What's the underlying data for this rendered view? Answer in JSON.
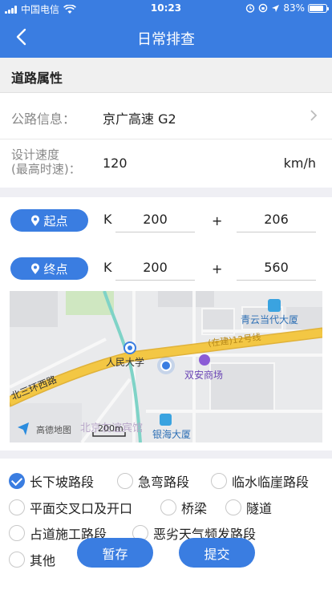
{
  "status_bar": {
    "carrier": "中国电信",
    "time": "10:23",
    "battery": "83%",
    "battery_level": 0.83
  },
  "nav": {
    "title": "日常排查",
    "back_icon": "chevron-left-icon"
  },
  "section": {
    "title": "道路属性"
  },
  "road": {
    "label": "公路信息：",
    "value": "京广高速 G2"
  },
  "speed": {
    "label_line1": "设计速度",
    "label_line2": "(最高时速)：",
    "value": "120",
    "unit": "km/h"
  },
  "start": {
    "label": "起点",
    "k": "K",
    "km": "200",
    "plus": "+",
    "m": "206"
  },
  "end": {
    "label": "终点",
    "k": "K",
    "km": "200",
    "plus": "+",
    "m": "560"
  },
  "map": {
    "labels": {
      "qingyun": "青云当代大厦",
      "route": "(在建)12号线",
      "renmin": "人民大学",
      "shuangan": "双安商场",
      "ring": "北三环西路",
      "hotel": "北京友谊宾馆",
      "yinhai": "银海大厦",
      "logo": "高德地图",
      "scale": "200m"
    },
    "colors": {
      "road": "#f3c744",
      "metro": "#7fd3c7",
      "background": "#e9eaec",
      "water": "#c6e3f5",
      "park": "#cfe7c1"
    }
  },
  "options": [
    {
      "label": "长下坡路段",
      "checked": true
    },
    {
      "label": "急弯路段",
      "checked": false
    },
    {
      "label": "临水临崖路段",
      "checked": false
    },
    {
      "label": "平面交叉口及开口",
      "checked": false
    },
    {
      "label": "桥梁",
      "checked": false
    },
    {
      "label": "隧道",
      "checked": false
    },
    {
      "label": "占道施工路段",
      "checked": false
    },
    {
      "label": "恶劣天气频发路段",
      "checked": false
    },
    {
      "label": "其他",
      "checked": false
    }
  ],
  "buttons": {
    "save": "暂存",
    "submit": "提交"
  },
  "colors": {
    "accent": "#3a7de1"
  }
}
